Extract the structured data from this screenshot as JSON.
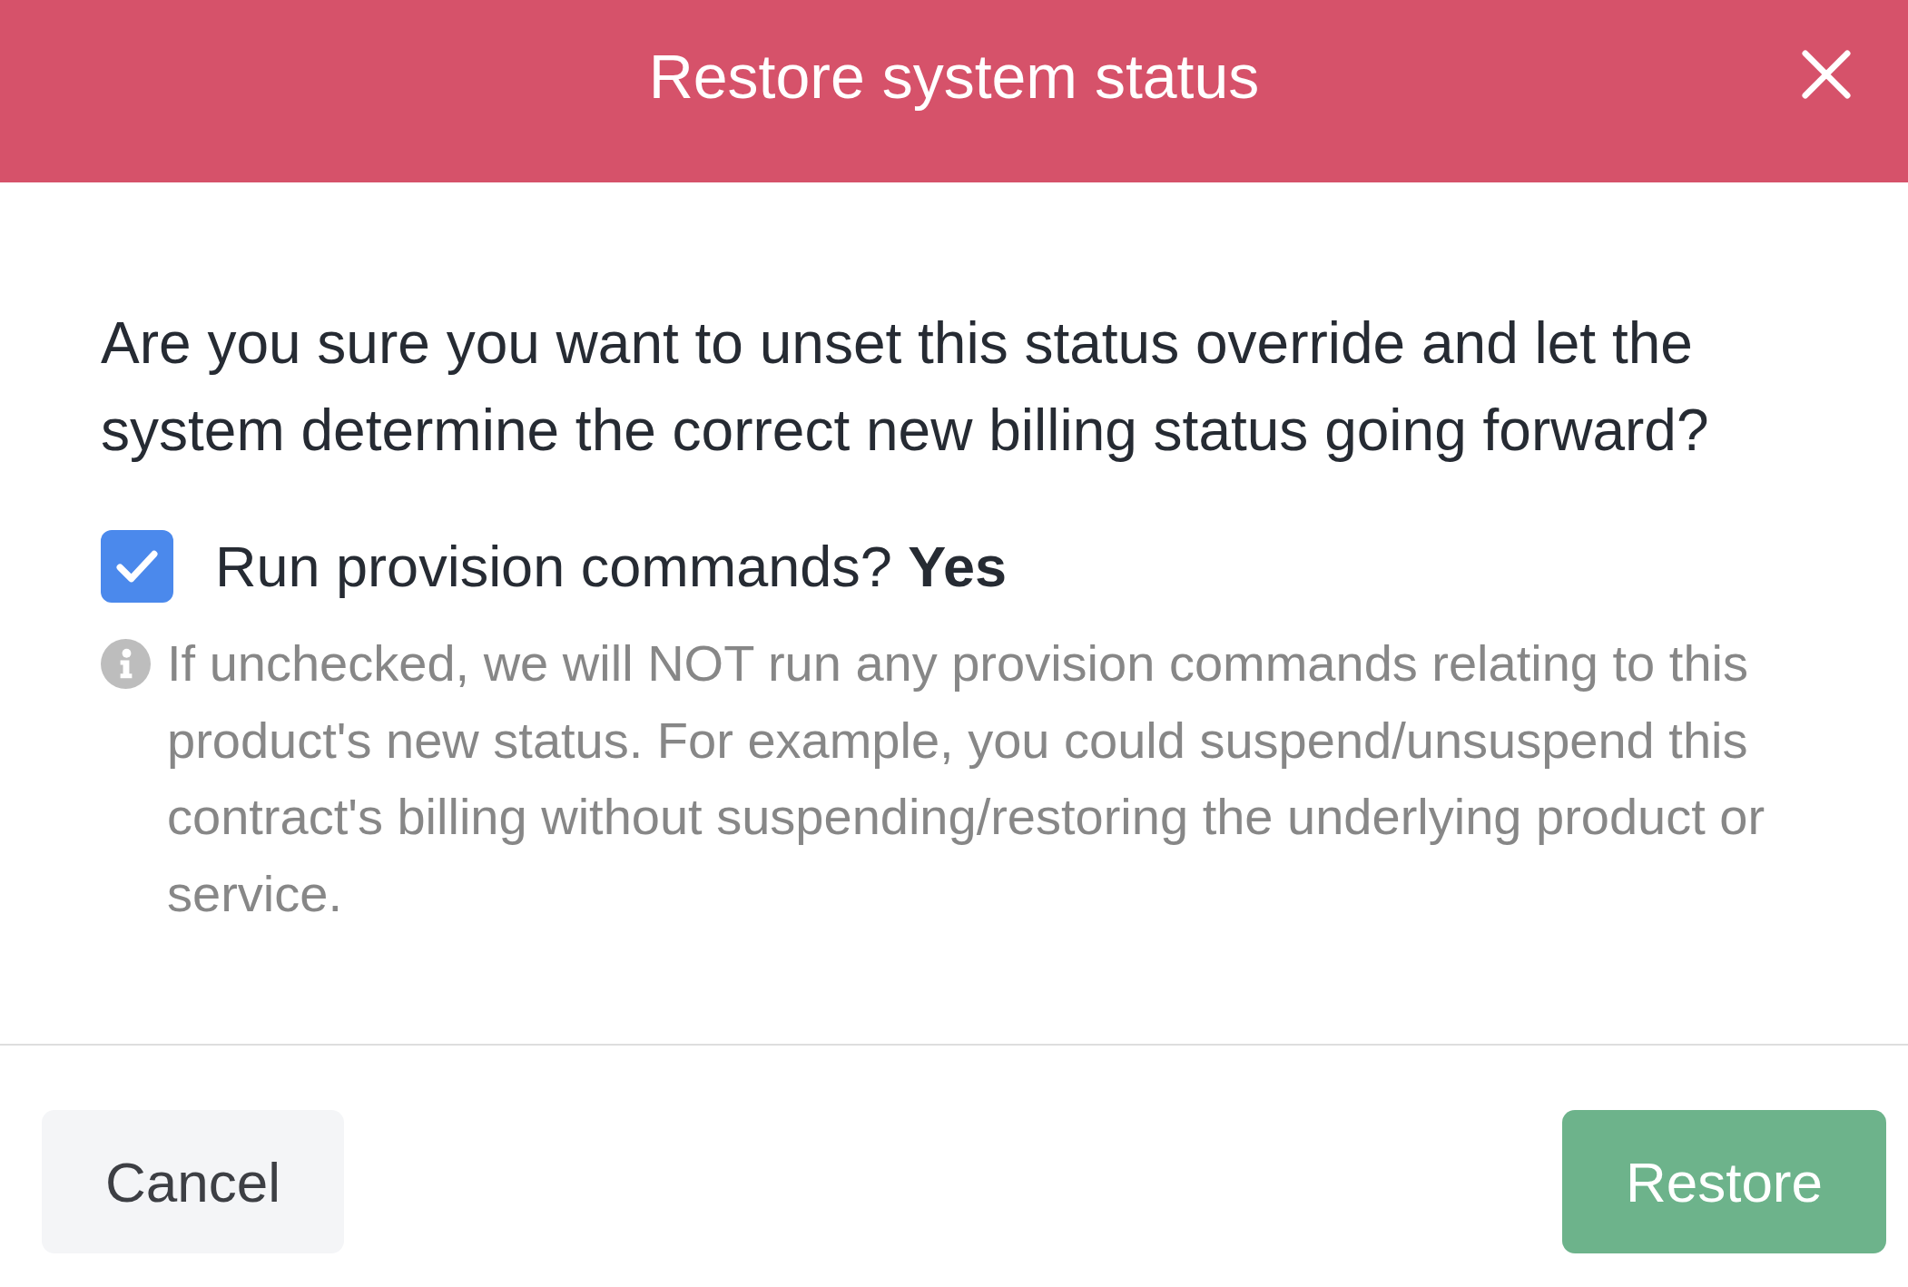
{
  "dialog": {
    "title": "Restore system status",
    "message": "Are you sure you want to unset this status override and let the system determine the correct new billing status going forward?",
    "option": {
      "label": "Run provision commands? **Yes**",
      "checked": true
    },
    "hint": "If unchecked, we will NOT run any provision commands relating to this product's new status. For example, you could suspend/unsuspend this contract's billing without suspending/restoring the underlying product or service.",
    "buttons": [
      {
        "label": "Cancel",
        "kind": "secondary"
      },
      {
        "label": "Restore",
        "kind": "primary"
      }
    ]
  }
}
